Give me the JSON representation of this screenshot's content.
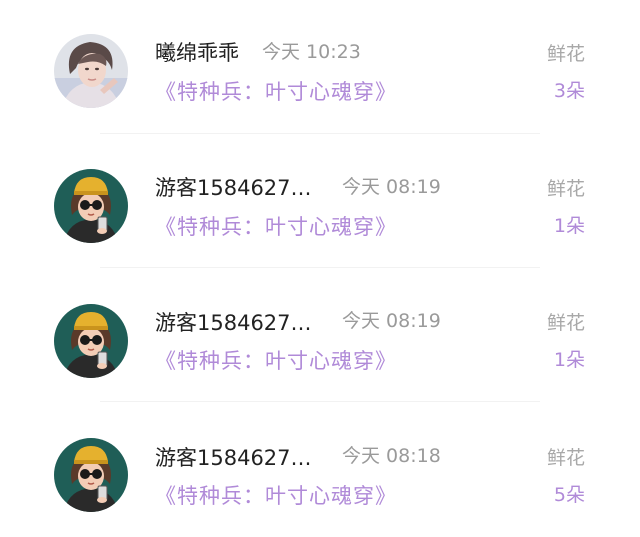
{
  "records": [
    {
      "user": "曦绵乖乖",
      "time": "今天 10:23",
      "book": "《特种兵：叶寸心魂穿》",
      "gift": "鲜花",
      "count": "3朵",
      "avatar": "photo-avatar-icon"
    },
    {
      "user": "游客1584627…",
      "time": "今天 08:19",
      "book": "《特种兵：叶寸心魂穿》",
      "gift": "鲜花",
      "count": "1朵",
      "avatar": "cartoon-girl-avatar-icon"
    },
    {
      "user": "游客1584627…",
      "time": "今天 08:19",
      "book": "《特种兵：叶寸心魂穿》",
      "gift": "鲜花",
      "count": "1朵",
      "avatar": "cartoon-girl-avatar-icon"
    },
    {
      "user": "游客1584627…",
      "time": "今天 08:18",
      "book": "《特种兵：叶寸心魂穿》",
      "gift": "鲜花",
      "count": "5朵",
      "avatar": "cartoon-girl-avatar-icon"
    }
  ],
  "colors": {
    "accent": "#b08ad8",
    "name": "#222222",
    "meta": "#9a9a9a",
    "avatar_bg": "#1f5e57"
  }
}
